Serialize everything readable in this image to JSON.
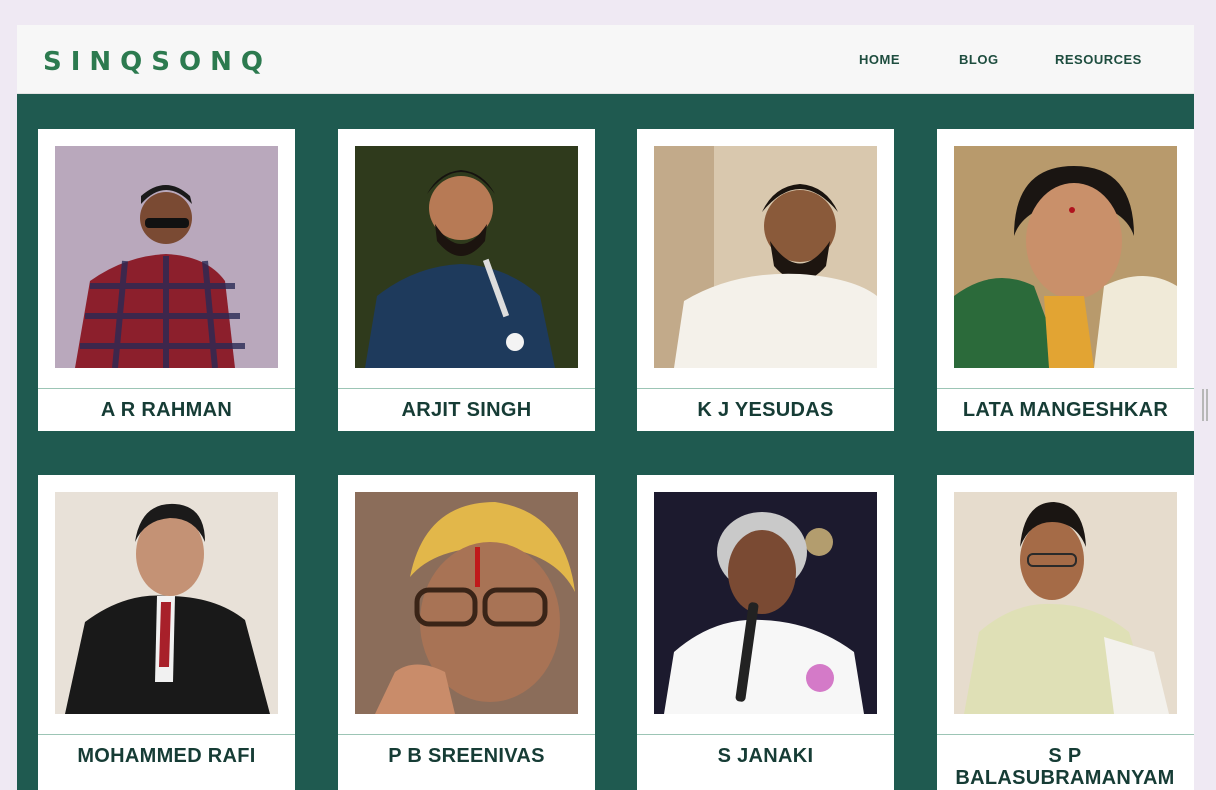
{
  "brand": {
    "logo": "SINQSONQ"
  },
  "nav": {
    "items": [
      "HOME",
      "BLOG",
      "RESOURCES"
    ]
  },
  "singers": [
    {
      "name": "A R RAHMAN"
    },
    {
      "name": "ARJIT SINGH"
    },
    {
      "name": "K J YESUDAS"
    },
    {
      "name": "LATA MANGESHKAR"
    },
    {
      "name": "MOHAMMED RAFI"
    },
    {
      "name": "P B SREENIVAS"
    },
    {
      "name": "S JANAKI"
    },
    {
      "name": "S P BALASUBRAMANYAM"
    }
  ],
  "colors": {
    "panel": "#1f5a50",
    "logo": "#2c7a4f",
    "nav_text": "#1e4d3f",
    "card_text": "#163c35"
  }
}
